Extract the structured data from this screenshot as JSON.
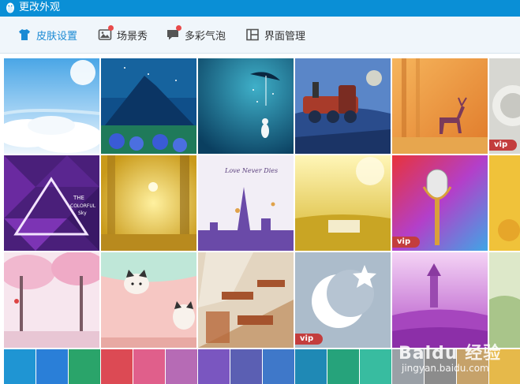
{
  "window": {
    "title": "更改外观"
  },
  "tabs": [
    {
      "label": "皮肤设置",
      "icon": "tshirt-icon",
      "active": true
    },
    {
      "label": "场景秀",
      "icon": "picture-icon",
      "badge": true
    },
    {
      "label": "多彩气泡",
      "icon": "chat-bubble-icon",
      "badge": true
    },
    {
      "label": "界面管理",
      "icon": "layout-icon"
    }
  ],
  "skins": {
    "vip_label": "vip",
    "tiles": [
      {
        "name": "sky-clouds",
        "vip": false
      },
      {
        "name": "blue-mountain",
        "vip": false
      },
      {
        "name": "umbrella-rabbit",
        "vip": false
      },
      {
        "name": "steam-train",
        "vip": false
      },
      {
        "name": "orange-deer",
        "vip": false
      },
      {
        "name": "grey-partial",
        "vip": true
      },
      {
        "name": "purple-triangles",
        "vip": false,
        "text": [
          "THE",
          "COLORFUL",
          "Sky"
        ]
      },
      {
        "name": "yellow-forest",
        "vip": false
      },
      {
        "name": "love-never-dies",
        "vip": false,
        "text": [
          "Love Never Dies"
        ]
      },
      {
        "name": "golden-field",
        "vip": false
      },
      {
        "name": "microphone",
        "vip": true
      },
      {
        "name": "yellow-partial",
        "vip": false
      },
      {
        "name": "cherry-blossom",
        "vip": false
      },
      {
        "name": "cat-pink",
        "vip": false
      },
      {
        "name": "classroom",
        "vip": false
      },
      {
        "name": "moon-star",
        "vip": true
      },
      {
        "name": "purple-castle",
        "vip": false
      },
      {
        "name": "green-partial",
        "vip": false
      }
    ]
  },
  "color_swatches": [
    "#1f95d3",
    "#2a7fd8",
    "#2aa46a",
    "#dc4a54",
    "#e05f8b",
    "#b66bb5",
    "#7a56c0",
    "#5b5fb3",
    "#3f78c9",
    "#1f89b5",
    "#26a37b",
    "#38bca0",
    "#9aa0a6",
    "#8c8c8c",
    "#c6a26a",
    "#e6b94a"
  ],
  "watermark": {
    "brand": "Baidu 经验",
    "sub": "jingyan.baidu.com"
  }
}
